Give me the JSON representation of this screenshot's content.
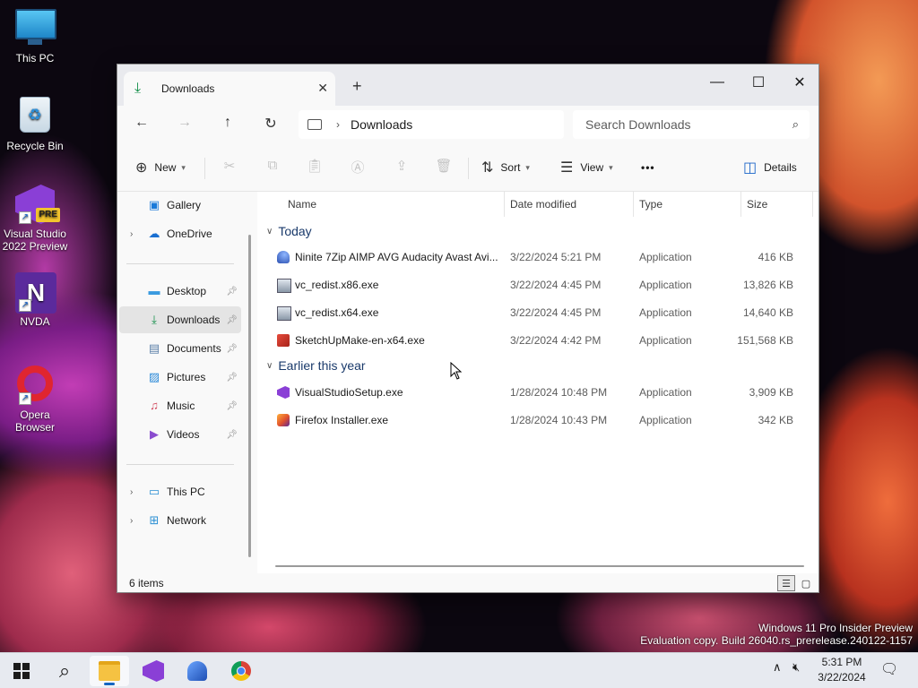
{
  "desktop": {
    "icons": [
      {
        "label": "This PC"
      },
      {
        "label": "Recycle Bin"
      },
      {
        "label": "Visual Studio 2022 Preview",
        "badge": "PRE"
      },
      {
        "label": "NVDA"
      },
      {
        "label": "Opera Browser"
      }
    ],
    "watermark_line1": "Windows 11 Pro Insider Preview",
    "watermark_line2": "Evaluation copy. Build 26040.rs_prerelease.240122-1157"
  },
  "window": {
    "tab_title": "Downloads",
    "new_tab_glyph": "+",
    "controls": {
      "minimize": "—",
      "maximize": "☐",
      "close": "✕"
    }
  },
  "nav": {
    "address_segment": "Downloads",
    "search_placeholder": "Search Downloads"
  },
  "toolbar": {
    "new_label": "New",
    "sort_label": "Sort",
    "view_label": "View",
    "more_glyph": "•••",
    "details_label": "Details"
  },
  "sidebar": {
    "items": [
      {
        "label": "Gallery",
        "icon": "gallery-icon"
      },
      {
        "label": "OneDrive",
        "icon": "cloud-icon"
      },
      {
        "label": "Desktop",
        "icon": "desktop-icon"
      },
      {
        "label": "Downloads",
        "icon": "download-icon"
      },
      {
        "label": "Documents",
        "icon": "document-icon"
      },
      {
        "label": "Pictures",
        "icon": "picture-icon"
      },
      {
        "label": "Music",
        "icon": "music-icon"
      },
      {
        "label": "Videos",
        "icon": "video-icon"
      },
      {
        "label": "This PC",
        "icon": "computer-icon"
      },
      {
        "label": "Network",
        "icon": "network-icon"
      }
    ]
  },
  "content": {
    "columns": [
      "Name",
      "Date modified",
      "Type",
      "Size"
    ],
    "groups": [
      {
        "label": "Today",
        "files": [
          {
            "name": "Ninite 7Zip AIMP AVG Audacity Avast Avi...",
            "date": "3/22/2024 5:21 PM",
            "type": "Application",
            "size": "416 KB"
          },
          {
            "name": "vc_redist.x86.exe",
            "date": "3/22/2024 4:45 PM",
            "type": "Application",
            "size": "13,826 KB"
          },
          {
            "name": "vc_redist.x64.exe",
            "date": "3/22/2024 4:45 PM",
            "type": "Application",
            "size": "14,640 KB"
          },
          {
            "name": "SketchUpMake-en-x64.exe",
            "date": "3/22/2024 4:42 PM",
            "type": "Application",
            "size": "151,568 KB"
          }
        ]
      },
      {
        "label": "Earlier this year",
        "files": [
          {
            "name": "VisualStudioSetup.exe",
            "date": "1/28/2024 10:48 PM",
            "type": "Application",
            "size": "3,909 KB"
          },
          {
            "name": "Firefox Installer.exe",
            "date": "1/28/2024 10:43 PM",
            "type": "Application",
            "size": "342 KB"
          }
        ]
      }
    ]
  },
  "status": {
    "item_count": "6 items"
  },
  "taskbar": {
    "time": "5:31 PM",
    "date": "3/22/2024"
  }
}
